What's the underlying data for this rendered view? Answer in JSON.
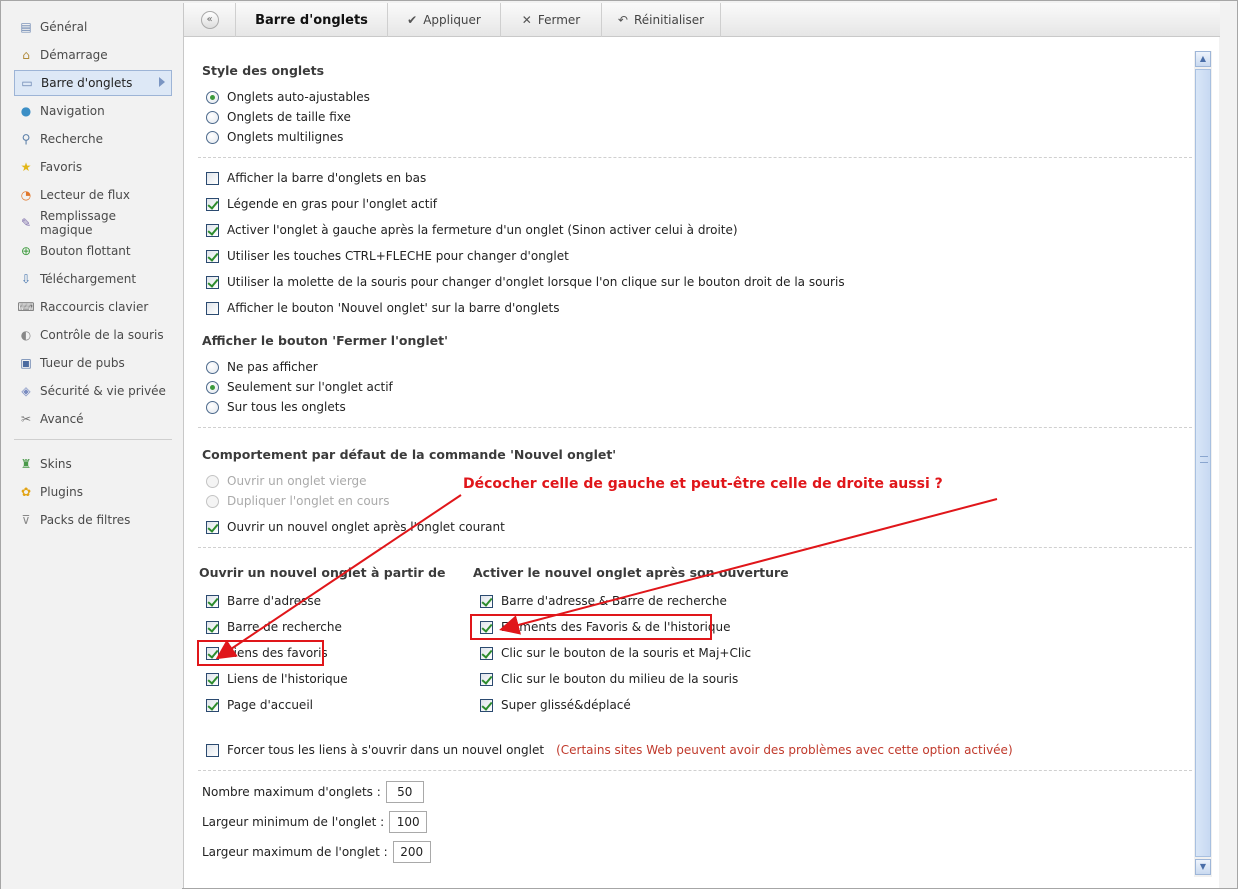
{
  "sidebar": {
    "items": [
      {
        "label": "Général",
        "icon": "general-page-icon"
      },
      {
        "label": "Démarrage",
        "icon": "home-icon"
      },
      {
        "label": "Barre d'onglets",
        "icon": "tab-bar-icon",
        "active": true
      },
      {
        "label": "Navigation",
        "icon": "globe-icon"
      },
      {
        "label": "Recherche",
        "icon": "magnifier-icon"
      },
      {
        "label": "Favoris",
        "icon": "star-icon"
      },
      {
        "label": "Lecteur de flux",
        "icon": "rss-icon"
      },
      {
        "label": "Remplissage magique",
        "icon": "magic-wand-icon"
      },
      {
        "label": "Bouton flottant",
        "icon": "float-button-icon"
      },
      {
        "label": "Téléchargement",
        "icon": "download-icon"
      },
      {
        "label": "Raccourcis clavier",
        "icon": "keyboard-icon"
      },
      {
        "label": "Contrôle de la souris",
        "icon": "mouse-icon"
      },
      {
        "label": "Tueur de pubs",
        "icon": "ad-blocker-icon"
      },
      {
        "label": "Sécurité & vie privée",
        "icon": "shield-icon"
      },
      {
        "label": "Avancé",
        "icon": "tools-icon"
      }
    ],
    "extra_items": [
      {
        "label": "Skins",
        "icon": "shirt-icon"
      },
      {
        "label": "Plugins",
        "icon": "puzzle-icon"
      },
      {
        "label": "Packs de filtres",
        "icon": "filter-icon"
      }
    ]
  },
  "toolbar": {
    "title": "Barre d'onglets",
    "apply_label": "Appliquer",
    "close_label": "Fermer",
    "reset_label": "Réinitialiser"
  },
  "tab_style": {
    "title": "Style des onglets",
    "options": [
      "Onglets auto-ajustables",
      "Onglets de taille fixe",
      "Onglets multilignes"
    ],
    "selected": 0
  },
  "general_checks": [
    {
      "label": "Afficher la barre d'onglets en bas",
      "checked": false
    },
    {
      "label": "Légende en gras pour l'onglet actif",
      "checked": true
    },
    {
      "label": "Activer l'onglet à gauche après la fermeture d'un onglet (Sinon activer celui à droite)",
      "checked": true
    },
    {
      "label": "Utiliser les touches CTRL+FLECHE pour changer d'onglet",
      "checked": true
    },
    {
      "label": "Utiliser la molette de la souris pour changer d'onglet lorsque l'on clique sur le bouton droit de la souris",
      "checked": true
    },
    {
      "label": "Afficher le bouton 'Nouvel onglet' sur la barre d'onglets",
      "checked": false
    }
  ],
  "close_button": {
    "title": "Afficher le bouton 'Fermer l'onglet'",
    "options": [
      "Ne pas afficher",
      "Seulement sur l'onglet actif",
      "Sur tous les onglets"
    ],
    "selected": 1
  },
  "new_tab_behavior": {
    "title": "Comportement par défaut de la commande 'Nouvel onglet'",
    "radios": [
      "Ouvrir un onglet vierge",
      "Dupliquer l'onglet en cours"
    ],
    "check_label": "Ouvrir un nouvel onglet après l'onglet courant",
    "check_checked": true
  },
  "open_from": {
    "title": "Ouvrir un nouvel onglet à partir de",
    "items": [
      {
        "label": "Barre d'adresse",
        "checked": true
      },
      {
        "label": "Barre de recherche",
        "checked": true
      },
      {
        "label": "Liens des favoris",
        "checked": true
      },
      {
        "label": "Liens de l'historique",
        "checked": true
      },
      {
        "label": "Page d'accueil",
        "checked": true
      }
    ]
  },
  "activate_after": {
    "title": "Activer le nouvel onglet après son ouverture",
    "items": [
      {
        "label": "Barre d'adresse & Barre de recherche",
        "checked": true
      },
      {
        "label": "Eléments des Favoris & de l'historique",
        "checked": true
      },
      {
        "label": "Clic sur le bouton de la souris et Maj+Clic",
        "checked": true
      },
      {
        "label": "Clic sur le bouton du milieu de la souris",
        "checked": true
      },
      {
        "label": "Super glissé&déplacé",
        "checked": true
      }
    ]
  },
  "force_links": {
    "label": "Forcer tous les liens à s'ouvrir dans un nouvel onglet",
    "warning": "(Certains sites Web peuvent avoir des problèmes avec cette option activée)",
    "checked": false
  },
  "limits": {
    "max_tabs_label": "Nombre maximum d'onglets :",
    "max_tabs_value": "50",
    "min_width_label": "Largeur minimum de l'onglet :",
    "min_width_value": "100",
    "max_width_label": "Largeur maximum de l'onglet :",
    "max_width_value": "200"
  },
  "annotation": {
    "text": "Décocher celle de gauche et peut-être celle de droite aussi ?",
    "color": "#e0161a"
  },
  "colors": {
    "accent": "#2d8c2d",
    "selection": "#dde8f6"
  }
}
